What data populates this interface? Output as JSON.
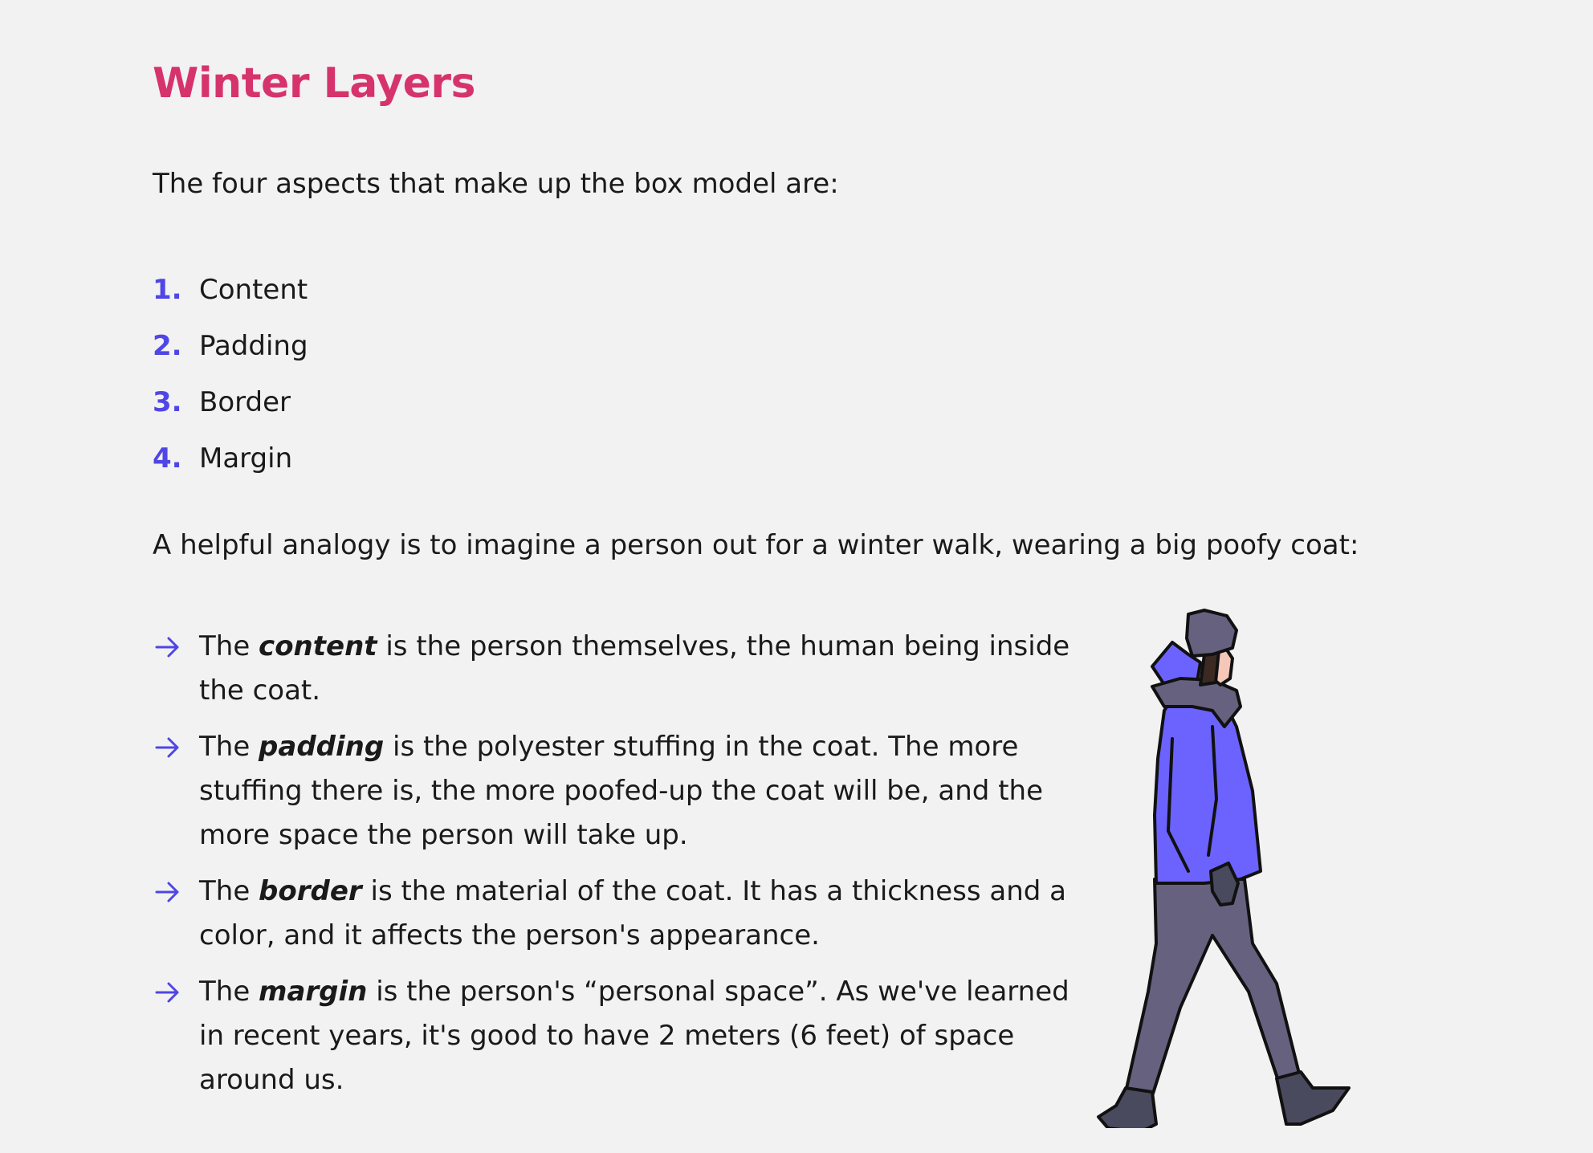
{
  "colors": {
    "title": "#d6336c",
    "accent": "#4f46e5",
    "coat": "#6c63ff",
    "pants": "#676180",
    "boots": "#4a4a5e"
  },
  "title": "Winter Layers",
  "intro": "The four aspects that make up the box model are:",
  "aspects": [
    {
      "num": "1.",
      "label": "Content"
    },
    {
      "num": "2.",
      "label": "Padding"
    },
    {
      "num": "3.",
      "label": "Border"
    },
    {
      "num": "4.",
      "label": "Margin"
    }
  ],
  "analogy": "A helpful analogy is to imagine a person out for a winter walk, wearing a big poofy coat:",
  "layers": [
    {
      "pre": "The ",
      "term": "content",
      "post": " is the person themselves, the human being inside the coat."
    },
    {
      "pre": "The ",
      "term": "padding",
      "post": " is the polyester stuffing in the coat. The more stuffing there is, the more poofed-up the coat will be, and the more space the person will take up."
    },
    {
      "pre": "The ",
      "term": "border",
      "post": " is the material of the coat. It has a thickness and a color, and it affects the person's appearance."
    },
    {
      "pre": "The ",
      "term": "margin",
      "post": " is the person's “personal space”. As we've learned in recent years, it's good to have 2 meters (6 feet) of space around us."
    }
  ],
  "icons": {
    "bullet": "arrow-right-icon",
    "figure": "walking-person-illustration"
  }
}
